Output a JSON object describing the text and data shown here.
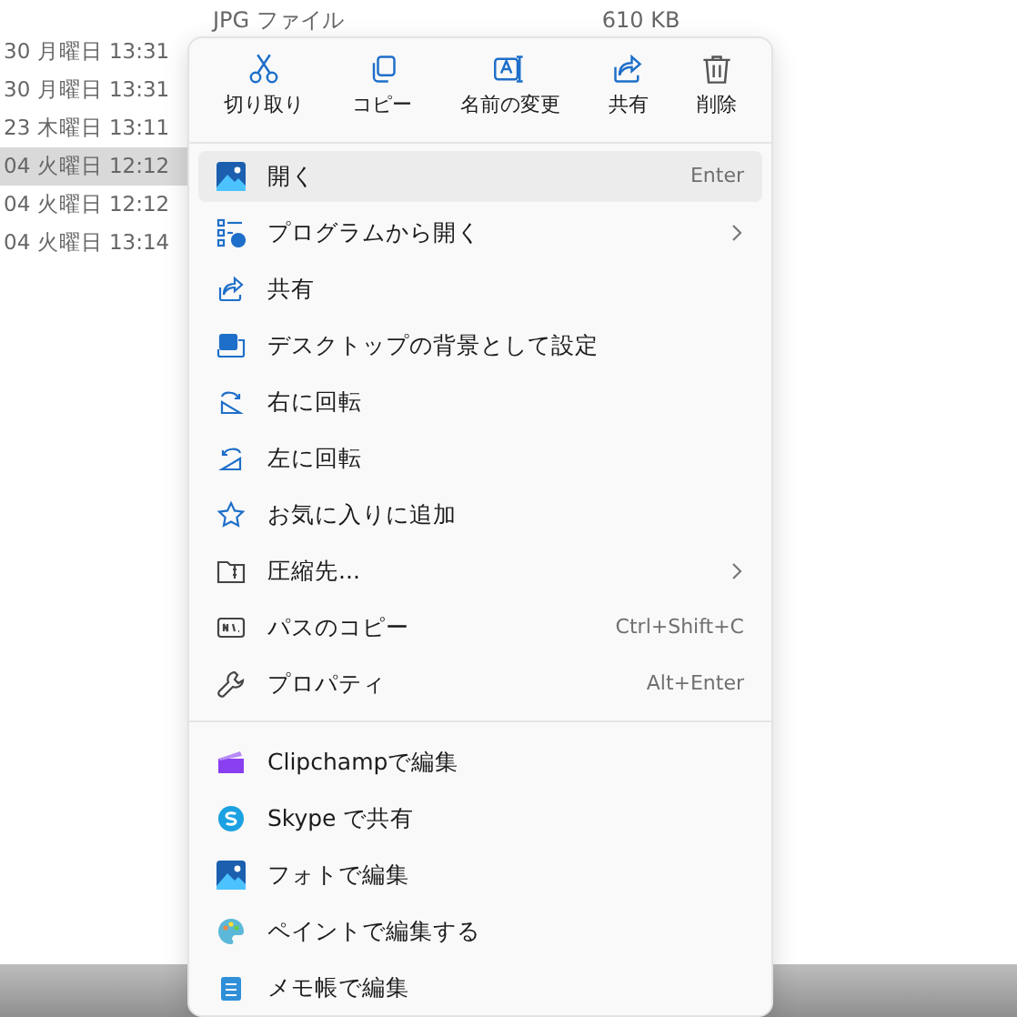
{
  "file_list": {
    "top_row": {
      "type": "JPG ファイル",
      "size": "610 KB"
    },
    "rows": [
      {
        "modified": "30 月曜日 13:31",
        "selected": false
      },
      {
        "modified": "30 月曜日 13:31",
        "selected": false
      },
      {
        "modified": "23 木曜日 13:11",
        "selected": false
      },
      {
        "modified": "04 火曜日 12:12",
        "selected": true
      },
      {
        "modified": "04 火曜日 12:12",
        "selected": false
      },
      {
        "modified": "04 火曜日 13:14",
        "selected": false
      }
    ]
  },
  "context_menu": {
    "toolbar": [
      {
        "label": "切り取り"
      },
      {
        "label": "コピー"
      },
      {
        "label": "名前の変更"
      },
      {
        "label": "共有"
      },
      {
        "label": "削除"
      }
    ],
    "items": [
      {
        "kind": "item",
        "label": "開く",
        "shortcut": "Enter",
        "submenu": false,
        "selected": true
      },
      {
        "kind": "item",
        "label": "プログラムから開く",
        "submenu": true,
        "selected": false
      },
      {
        "kind": "item",
        "label": "共有",
        "submenu": false,
        "selected": false
      },
      {
        "kind": "item",
        "label": "デスクトップの背景として設定",
        "submenu": false,
        "selected": false
      },
      {
        "kind": "item",
        "label": "右に回転",
        "submenu": false,
        "selected": false
      },
      {
        "kind": "item",
        "label": "左に回転",
        "submenu": false,
        "selected": false
      },
      {
        "kind": "item",
        "label": "お気に入りに追加",
        "submenu": false,
        "selected": false
      },
      {
        "kind": "item",
        "label": "圧縮先...",
        "submenu": true,
        "selected": false
      },
      {
        "kind": "item",
        "label": "パスのコピー",
        "shortcut": "Ctrl+Shift+C",
        "submenu": false,
        "selected": false
      },
      {
        "kind": "item",
        "label": "プロパティ",
        "shortcut": "Alt+Enter",
        "submenu": false,
        "selected": false
      },
      {
        "kind": "separator"
      },
      {
        "kind": "item",
        "label": "Clipchampで編集",
        "submenu": false,
        "selected": false
      },
      {
        "kind": "item",
        "label": "Skype で共有",
        "submenu": false,
        "selected": false
      },
      {
        "kind": "item",
        "label": "フォトで編集",
        "submenu": false,
        "selected": false
      },
      {
        "kind": "item",
        "label": "ペイントで編集する",
        "submenu": false,
        "selected": false
      },
      {
        "kind": "item",
        "label": "メモ帳で編集",
        "submenu": false,
        "selected": false
      }
    ]
  }
}
